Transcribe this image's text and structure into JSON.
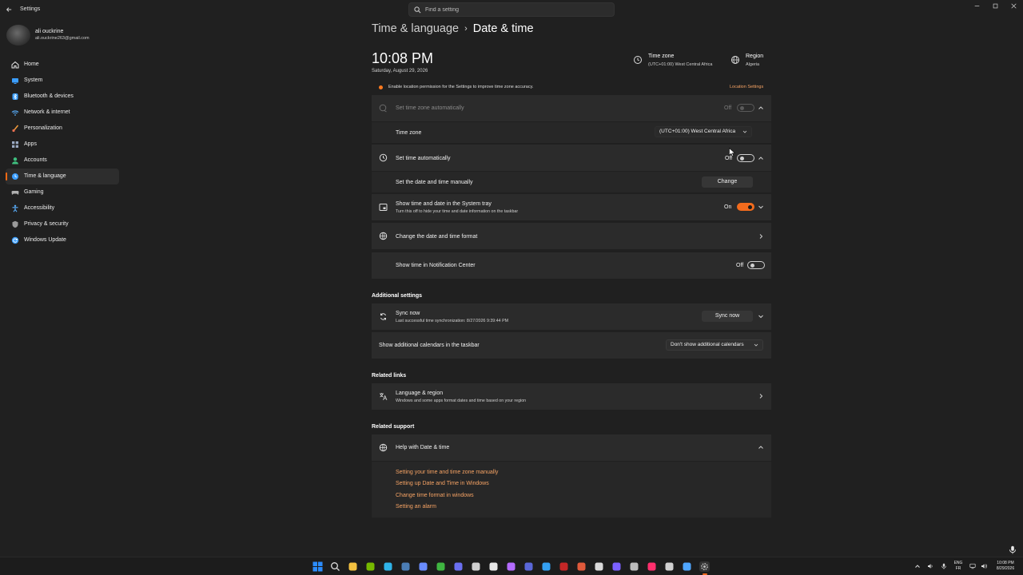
{
  "window": {
    "title": "Settings",
    "search_placeholder": "Find a setting"
  },
  "user": {
    "name": "ali ouckrine",
    "email": "ali.ouckrine263@gmail.com"
  },
  "sidebar": {
    "items": [
      {
        "label": "Home",
        "icon": "home-icon",
        "color": "#e9e9e9"
      },
      {
        "label": "System",
        "icon": "system-icon",
        "color": "#3b9eff"
      },
      {
        "label": "Bluetooth & devices",
        "icon": "bluetooth-icon",
        "color": "#3b9eff"
      },
      {
        "label": "Network & internet",
        "icon": "wifi-icon",
        "color": "#5ab0ff"
      },
      {
        "label": "Personalization",
        "icon": "brush-icon",
        "color": "#f39c3c"
      },
      {
        "label": "Apps",
        "icon": "apps-icon",
        "color": "#9aa9c2"
      },
      {
        "label": "Accounts",
        "icon": "accounts-icon",
        "color": "#3fbf7f"
      },
      {
        "label": "Time & language",
        "icon": "globe-clock-icon",
        "color": "#3b9eff",
        "active": true
      },
      {
        "label": "Gaming",
        "icon": "gaming-icon",
        "color": "#b0b0b0"
      },
      {
        "label": "Accessibility",
        "icon": "accessibility-icon",
        "color": "#5ab0ff"
      },
      {
        "label": "Privacy & security",
        "icon": "shield-icon",
        "color": "#9a9a9a"
      },
      {
        "label": "Windows Update",
        "icon": "update-icon",
        "color": "#3b9eff"
      }
    ]
  },
  "header": {
    "parent": "Time & language",
    "separator": "›",
    "current": "Date & time"
  },
  "clock": {
    "time": "10:08 PM",
    "date": "Saturday, August 29, 2026"
  },
  "timezone_info": {
    "title": "Time zone",
    "value": "(UTC+01:00) West Central Africa"
  },
  "region_info": {
    "title": "Region",
    "value": "Algeria"
  },
  "notice": {
    "text": "Enable location permission for the Settings to improve time zone accuracy.",
    "link": "Location Settings"
  },
  "settings": {
    "tz_auto": {
      "label": "Set time zone automatically",
      "state": "Off"
    },
    "time_zone": {
      "label": "Time zone",
      "value": "(UTC+01:00) West Central Africa"
    },
    "time_auto": {
      "label": "Set time automatically",
      "state": "Off"
    },
    "manual": {
      "label": "Set the date and time manually",
      "button": "Change"
    },
    "tray": {
      "label": "Show time and date in the System tray",
      "sub": "Turn this off to hide your time and date information on the taskbar",
      "state": "On"
    },
    "format": {
      "label": "Change the date and time format"
    },
    "notif": {
      "label": "Show time in Notification Center",
      "state": "Off"
    }
  },
  "additional": {
    "title": "Additional settings",
    "sync": {
      "label": "Sync now",
      "sub": "Last successful time synchronization: 8/27/2026 9:39:44 PM",
      "button": "Sync now"
    },
    "calendars": {
      "label": "Show additional calendars in the taskbar",
      "value": "Don't show additional calendars"
    }
  },
  "related_links": {
    "title": "Related links",
    "language": {
      "label": "Language & region",
      "sub": "Windows and some apps format dates and time based on your region"
    }
  },
  "related_support": {
    "title": "Related support",
    "help": {
      "label": "Help with Date & time"
    },
    "links": [
      "Setting your time and time zone manually",
      "Setting up Date and Time in Windows",
      "Change time format in windows",
      "Setting an alarm"
    ]
  },
  "tray": {
    "lang": "ENG",
    "kbd": "FR",
    "time": "10:08 PM",
    "date": "8/29/2026"
  },
  "taskbar_icons": [
    {
      "name": "start-icon",
      "color": "#2b8cff"
    },
    {
      "name": "search-icon",
      "color": "#dddddd"
    },
    {
      "name": "file-explorer-icon",
      "color": "#f3c140"
    },
    {
      "name": "nvidia-icon",
      "color": "#76b900"
    },
    {
      "name": "edge-icon",
      "color": "#2fb3e8"
    },
    {
      "name": "steam-icon",
      "color": "#4b7db5"
    },
    {
      "name": "globe-icon",
      "color": "#6a8cff"
    },
    {
      "name": "xbox-icon",
      "color": "#3fb541"
    },
    {
      "name": "discord-icon",
      "color": "#6a6ff0"
    },
    {
      "name": "epic-icon",
      "color": "#d0d0d0"
    },
    {
      "name": "google-icon",
      "color": "#e8e8e8"
    },
    {
      "name": "obs-icon",
      "color": "#b46bff"
    },
    {
      "name": "app-purple-icon",
      "color": "#5a67d8"
    },
    {
      "name": "vpn-icon",
      "color": "#34a0f2"
    },
    {
      "name": "red-app-icon",
      "color": "#c42727"
    },
    {
      "name": "tools-icon",
      "color": "#e05a3b"
    },
    {
      "name": "chrome-icon",
      "color": "#d9d9d9"
    },
    {
      "name": "editor-icon",
      "color": "#7b61ff"
    },
    {
      "name": "capture-icon",
      "color": "#bdbdbd"
    },
    {
      "name": "tiktok-icon",
      "color": "#ff2f6d"
    },
    {
      "name": "media-icon",
      "color": "#d0d0d0"
    },
    {
      "name": "remote-icon",
      "color": "#4fa6ff"
    },
    {
      "name": "settings-icon",
      "color": "#bdbdbd",
      "active": true
    }
  ],
  "colors": {
    "accent": "#f26b1d",
    "link": "#f6a364",
    "background": "#202020",
    "card": "#2b2b2b"
  }
}
